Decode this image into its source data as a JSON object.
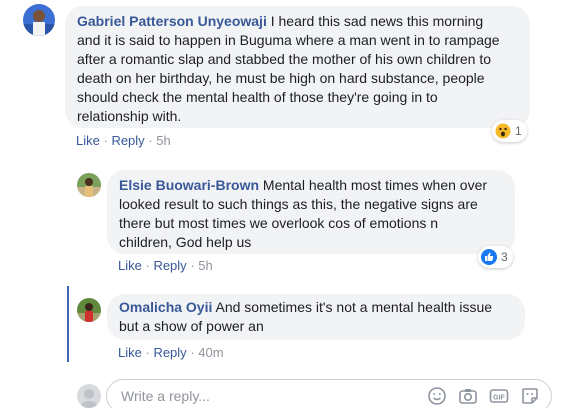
{
  "comments": [
    {
      "author": "Gabriel Patterson Unyeowaji",
      "lines": [
        "I heard this sad news this morning",
        "and it is said to happen in Buguma where a man went in to rampage",
        "after a romantic slap and stabbed the mother of his own children to",
        "death on her birthday, he must be high on hard substance, people",
        "should check the mental health of those they're going in to",
        "relationship with."
      ],
      "like_label": "Like",
      "reply_label": "Reply",
      "time": "5h",
      "reaction_icon": "wow-emoji",
      "reaction_count": "1"
    },
    {
      "author": "Elsie Buowari-Brown",
      "lines": [
        "Mental health most times when over",
        "looked result to such things as this, the negative signs are",
        "there but most times we overlook cos of emotions n",
        "children, God help us"
      ],
      "like_label": "Like",
      "reply_label": "Reply",
      "time": "5h",
      "reaction_icon": "thumbs-up",
      "reaction_count": "3"
    },
    {
      "author": "Omalicha Oyii",
      "lines": [
        "And sometimes it's not a mental health issue",
        "but a show of power an"
      ],
      "like_label": "Like",
      "reply_label": "Reply",
      "time": "40m"
    }
  ],
  "reply_box": {
    "placeholder": "Write a reply..."
  },
  "colors": {
    "link": "#385898",
    "bubble": "#f2f3f5",
    "meta": "#90949c",
    "accent": "#4267b2"
  }
}
